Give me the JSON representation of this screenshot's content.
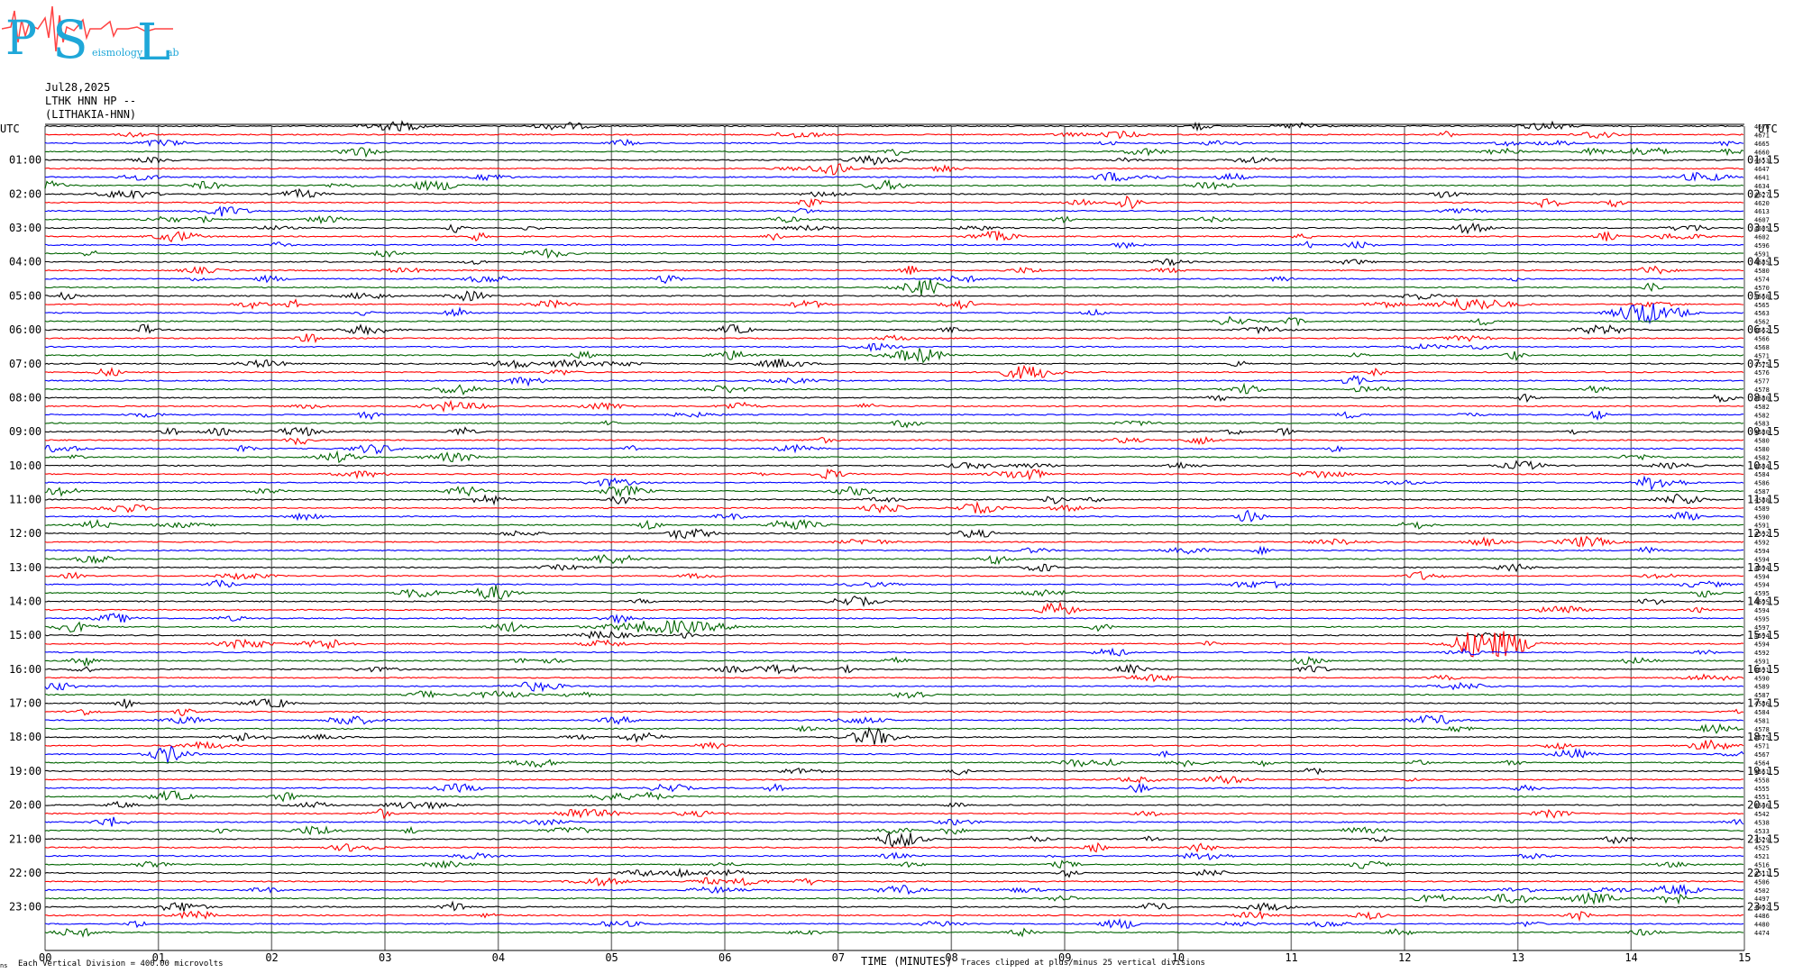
{
  "logo": {
    "letters": [
      "P",
      "S",
      "L"
    ],
    "subtitle_fragments": [
      "eismology",
      "ab"
    ]
  },
  "header": {
    "date": "Jul28,2025",
    "station": "LTHK HNN HP --",
    "location": "(LITHAKIA-HNN)"
  },
  "labels": {
    "utc_left": "UTC",
    "utc_right": "UTC",
    "xlabel": "TIME (MINUTES)",
    "clip_note": "Traces clipped at plus/minus 25 vertical divisions",
    "scale_note": "Each Vertical Division =  400.00 microvolts",
    "corner_mark": "ns"
  },
  "colors": {
    "black": "#000000",
    "red": "#ff0000",
    "blue": "#0000ff",
    "green": "#006400",
    "grid": "#808080"
  },
  "chart_data": {
    "type": "line",
    "title": "",
    "xlabel": "TIME (MINUTES)",
    "ylabel": "",
    "xlim": [
      0,
      15
    ],
    "x_ticks": [
      "00",
      "01",
      "02",
      "03",
      "04",
      "05",
      "06",
      "07",
      "08",
      "09",
      "10",
      "11",
      "12",
      "13",
      "14",
      "15"
    ],
    "grid": "vertical every minute",
    "trace_count": 96,
    "trace_color_cycle": [
      "black",
      "red",
      "blue",
      "green"
    ],
    "left_hour_labels": [
      "01:00",
      "02:00",
      "03:00",
      "04:00",
      "05:00",
      "06:00",
      "07:00",
      "08:00",
      "09:00",
      "10:00",
      "11:00",
      "12:00",
      "13:00",
      "14:00",
      "15:00",
      "16:00",
      "17:00",
      "18:00",
      "19:00",
      "20:00",
      "21:00",
      "22:00",
      "23:00"
    ],
    "right_hour_labels": [
      "01:15",
      "02:15",
      "03:15",
      "04:15",
      "05:15",
      "06:15",
      "07:15",
      "08:15",
      "09:15",
      "10:15",
      "11:15",
      "12:15",
      "13:15",
      "14:15",
      "15:15",
      "16:15",
      "17:15",
      "18:15",
      "19:15",
      "20:15",
      "21:15",
      "22:15",
      "23:15"
    ],
    "right_trace_values": [
      4676,
      4671,
      4665,
      4660,
      4653,
      4647,
      4641,
      4634,
      4627,
      4620,
      4613,
      4607,
      4605,
      4602,
      4596,
      4591,
      4585,
      4580,
      4574,
      4570,
      4568,
      4565,
      4563,
      4562,
      4562,
      4566,
      4568,
      4571,
      4575,
      4576,
      4577,
      4578,
      4580,
      4582,
      4582,
      4583,
      4580,
      4580,
      4580,
      4582,
      4584,
      4584,
      4586,
      4587,
      4588,
      4589,
      4590,
      4591,
      4592,
      4592,
      4594,
      4594,
      4594,
      4594,
      4594,
      4595,
      4595,
      4594,
      4595,
      4597,
      4594,
      4594,
      4592,
      4591,
      4591,
      4590,
      4589,
      4587,
      4586,
      4584,
      4581,
      4578,
      4575,
      4571,
      4567,
      4564,
      4561,
      4558,
      4555,
      4551,
      4546,
      4542,
      4538,
      4533,
      4529,
      4525,
      4521,
      4516,
      4511,
      4506,
      4502,
      4497,
      4492,
      4486,
      4480,
      4474
    ],
    "events": [
      {
        "row": 21,
        "minute": 12.6,
        "amp": 1.0,
        "width": 0.5
      },
      {
        "row": 22,
        "minute": 14.1,
        "amp": 1.8,
        "width": 0.35
      },
      {
        "row": 29,
        "minute": 8.6,
        "amp": 0.7,
        "width": 0.3
      },
      {
        "row": 31,
        "minute": 6.0,
        "amp": 0.6,
        "width": 0.3
      },
      {
        "row": 59,
        "minute": 5.5,
        "amp": 1.0,
        "width": 0.8
      },
      {
        "row": 61,
        "minute": 12.8,
        "amp": 2.2,
        "width": 0.5
      },
      {
        "row": 64,
        "minute": 6.5,
        "amp": 0.7,
        "width": 0.3
      },
      {
        "row": 72,
        "minute": 7.3,
        "amp": 1.4,
        "width": 0.3
      },
      {
        "row": 74,
        "minute": 1.1,
        "amp": 1.3,
        "width": 0.25
      },
      {
        "row": 73,
        "minute": 14.7,
        "amp": 0.8,
        "width": 0.3
      },
      {
        "row": 92,
        "minute": 1.2,
        "amp": 0.8,
        "width": 0.3
      },
      {
        "row": 55,
        "minute": 3.3,
        "amp": 0.8,
        "width": 0.25
      }
    ]
  }
}
